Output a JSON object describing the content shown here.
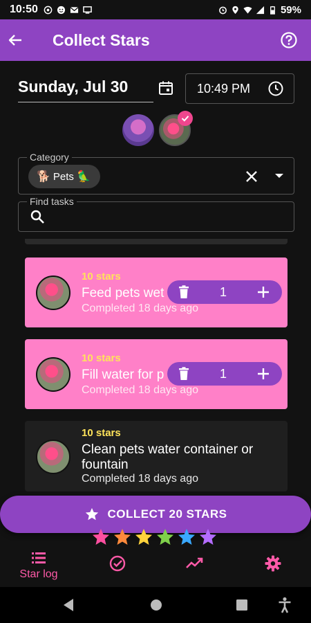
{
  "status_bar": {
    "time": "10:50",
    "battery": "59%"
  },
  "app_bar": {
    "title": "Collect Stars"
  },
  "date_picker": {
    "date": "Sunday, Jul 30",
    "time": "10:49 PM"
  },
  "category": {
    "label": "Category",
    "chip_left_emoji": "🐕",
    "chip_text": "Pets",
    "chip_right_emoji": "🦜"
  },
  "search": {
    "label": "Find tasks"
  },
  "tasks": [
    {
      "stars": "10 stars",
      "name": "Feed pets wet",
      "completed": "Completed 18 days ago",
      "quantity": "1",
      "selected": true
    },
    {
      "stars": "10 stars",
      "name": "Fill water for p",
      "completed": "Completed 18 days ago",
      "quantity": "1",
      "selected": true
    },
    {
      "stars": "10 stars",
      "name": "Clean pets water container or fountain",
      "completed": "Completed 18 days ago",
      "selected": false
    }
  ],
  "collect_button": {
    "label": "COLLECT 20 STARS"
  },
  "bottom_nav": {
    "items": [
      {
        "label": "Star log",
        "icon": "list-icon"
      },
      {
        "label": "",
        "icon": "check-circle-icon"
      },
      {
        "label": "",
        "icon": "trending-icon"
      },
      {
        "label": "",
        "icon": "gear-icon"
      }
    ]
  },
  "colors": {
    "primary": "#8e44c2",
    "selected_card": "#ff80c8",
    "accent": "#ff5aa8",
    "stars_text": "#ffe35a"
  }
}
